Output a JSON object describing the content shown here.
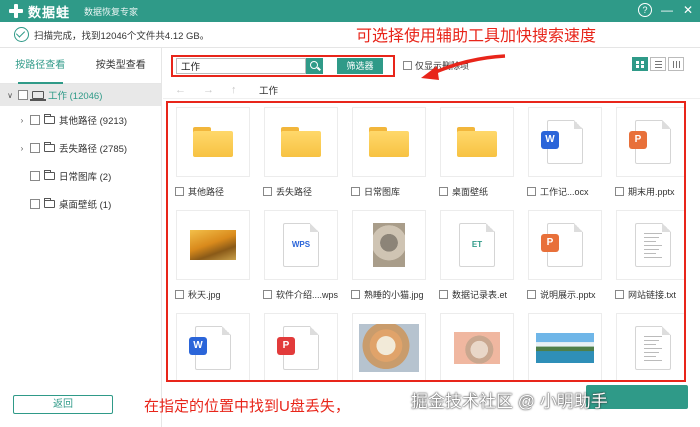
{
  "app": {
    "name": "数据蛙",
    "subtitle": "数据恢复专家",
    "help_glyph": "?",
    "minimize_glyph": "—",
    "close_glyph": "✕"
  },
  "status": {
    "text": "扫描完成，找到12046个文件共4.12 GB。"
  },
  "annotations": {
    "top": "可选择使用辅助工具加快搜索速度",
    "bottom": "在指定的位置中找到U盘丢失，",
    "watermark": "掘金技术社区 @ 小明助手"
  },
  "sidebar": {
    "tabs": [
      {
        "label": "按路径查看",
        "active": true
      },
      {
        "label": "按类型查看",
        "active": false
      }
    ],
    "root": {
      "label": "工作 (12046)",
      "caret": "∨"
    },
    "items": [
      {
        "label": "其他路径 (9213)",
        "caret": "›"
      },
      {
        "label": "丢失路径 (2785)",
        "caret": "›"
      },
      {
        "label": "日常图库 (2)",
        "caret": ""
      },
      {
        "label": "桌面壁纸 (1)",
        "caret": ""
      }
    ],
    "back_label": "返回"
  },
  "toolbar": {
    "search_value": "工作",
    "filter_label": "筛选器",
    "deleted_only_label": "仅显示删除项"
  },
  "nav": {
    "back_glyph": "←",
    "forward_glyph": "→",
    "up_glyph": "↑",
    "breadcrumb": "工作"
  },
  "files": [
    {
      "name": "其他路径",
      "kind": "folder"
    },
    {
      "name": "丢失路径",
      "kind": "folder"
    },
    {
      "name": "日常图库",
      "kind": "folder"
    },
    {
      "name": "桌面壁纸",
      "kind": "folder"
    },
    {
      "name": "工作记...ocx",
      "kind": "word",
      "badge": "W"
    },
    {
      "name": "期末用.pptx",
      "kind": "ppt",
      "badge": "P"
    },
    {
      "name": "秋天.jpg",
      "kind": "photo-autumn"
    },
    {
      "name": "软件介绍....wps",
      "kind": "wps",
      "badge": "WPS"
    },
    {
      "name": "熟睡的小猫.jpg",
      "kind": "photo-cat"
    },
    {
      "name": "数据记录表.et",
      "kind": "et",
      "badge": "ET"
    },
    {
      "name": "说明展示.pptx",
      "kind": "ppt",
      "badge": "P"
    },
    {
      "name": "网站链接.txt",
      "kind": "txt"
    },
    {
      "name": "",
      "kind": "word",
      "badge": "W"
    },
    {
      "name": "",
      "kind": "pdf",
      "badge": "P"
    },
    {
      "name": "",
      "kind": "photo-kitten"
    },
    {
      "name": "",
      "kind": "photo-rabbit"
    },
    {
      "name": "",
      "kind": "photo-lake"
    },
    {
      "name": "",
      "kind": "txt"
    }
  ],
  "colors": {
    "accent": "#2f9a88",
    "annotation_red": "#e8251a",
    "word": "#2b65d9",
    "ppt": "#e8703a",
    "pdf": "#e23b3b",
    "wps": "#2b65d9",
    "et": "#2f9a88"
  }
}
